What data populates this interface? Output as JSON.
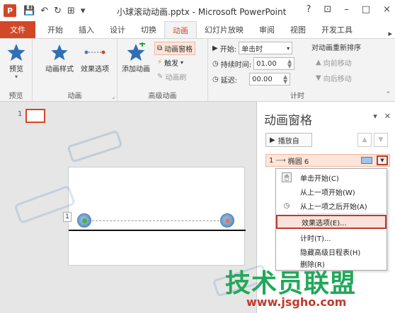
{
  "titlebar": {
    "app_icon": "P",
    "title": "小球滚动动画.pptx - Microsoft PowerPoint",
    "controls": [
      "?",
      "⊡",
      "–",
      "□",
      "×"
    ]
  },
  "tabs": [
    {
      "label": "文件",
      "kind": "file"
    },
    {
      "label": "开始"
    },
    {
      "label": "插入"
    },
    {
      "label": "设计"
    },
    {
      "label": "切换"
    },
    {
      "label": "动画",
      "active": true
    },
    {
      "label": "幻灯片放映"
    },
    {
      "label": "审阅"
    },
    {
      "label": "视图"
    },
    {
      "label": "开发工具"
    }
  ],
  "ribbon": {
    "preview": {
      "button": "预览",
      "group": "预览"
    },
    "animation": {
      "styles": "动画样式",
      "effect_options": "效果选项",
      "group": "动画"
    },
    "advanced": {
      "add_animation": "添加动画",
      "anim_pane": "动画窗格",
      "trigger": "触发",
      "painter": "动画刷",
      "group": "高级动画"
    },
    "timing": {
      "start_label": "开始:",
      "start_value": "单击时",
      "duration_label": "持续时间:",
      "duration_value": "01.00",
      "delay_label": "延迟:",
      "delay_value": "00.00",
      "reorder_title": "对动画重新排序",
      "move_earlier": "向前移动",
      "move_later": "向后移动",
      "group": "计时"
    }
  },
  "thumbnails": [
    {
      "number": "1"
    }
  ],
  "slide": {
    "anim_tag": "1"
  },
  "animpane": {
    "title": "动画窗格",
    "play_button": "播放自",
    "item": {
      "index": "1",
      "label": "椭圆 6"
    }
  },
  "context_menu": {
    "items": [
      {
        "label": "单击开始(C)",
        "icon": "mouse-click-icon"
      },
      {
        "label": "从上一项开始(W)"
      },
      {
        "label": "从上一项之后开始(A)",
        "icon": "clock-icon"
      },
      {
        "label": "效果选项(E)...",
        "highlighted": true
      },
      {
        "label": "计时(T)..."
      },
      {
        "label": "隐藏高级日程表(H)"
      },
      {
        "label": "删除(R)"
      }
    ]
  },
  "watermarks": {
    "brand": "技术员联盟",
    "url": "www.jsgho.com"
  },
  "colors": {
    "accent": "#d24726",
    "highlight_border": "#c0392b",
    "brand_green": "#22a85a"
  }
}
